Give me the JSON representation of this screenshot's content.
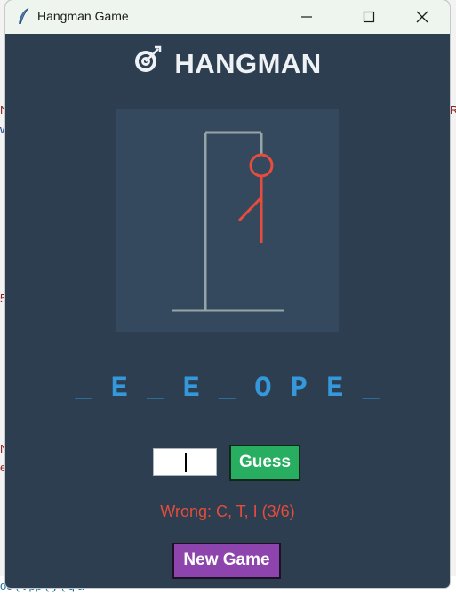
{
  "background": {
    "left_fragments": [
      "N",
      "w",
      "5",
      "N",
      "e"
    ],
    "right_fragments": [
      "R"
    ],
    "bottom_strip": "oc        (        t    pp   (    y            (    q    a"
  },
  "window": {
    "title": "Hangman Game",
    "controls": [
      "minimize-icon",
      "maximize-icon",
      "close-icon"
    ]
  },
  "game": {
    "heading": "HANGMAN",
    "heading_icon": "dart-target-icon",
    "word_display": "_ E _ E _ O P E _",
    "input_value": "",
    "guess_label": "Guess",
    "wrong_text": "Wrong: C, T, I (3/6)",
    "new_game_label": "New Game",
    "wrong_count": 3,
    "max_wrong": 6
  },
  "colors": {
    "window_bg": "#2d3e50",
    "canvas_bg": "#34495e",
    "word": "#3498db",
    "wrong": "#e74c3c",
    "guess_button": "#27ae60",
    "new_game_button": "#8e44ad",
    "gallows": "#95a5a6",
    "figure": "#e74c3c"
  }
}
